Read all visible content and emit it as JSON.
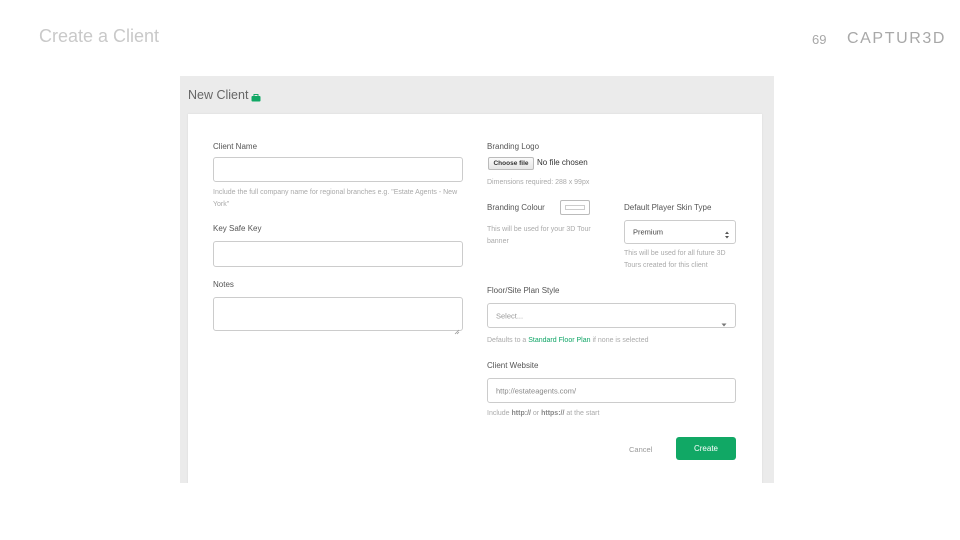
{
  "slide": {
    "title": "Create a Client",
    "page_number": "69",
    "brand": "CAPTUR3D"
  },
  "form": {
    "header_title": "New Client",
    "header_icon": "briefcase-icon",
    "client_name": {
      "label": "Client Name",
      "value": "",
      "hint": "Include the full company name for regional branches e.g. \"Estate Agents - New York\""
    },
    "key_safe_key": {
      "label": "Key Safe Key",
      "value": ""
    },
    "notes": {
      "label": "Notes",
      "value": ""
    },
    "branding_logo": {
      "label": "Branding Logo",
      "button_label": "Choose file",
      "file_status": "No file chosen",
      "hint": "Dimensions required: 288 x 99px"
    },
    "branding_colour": {
      "label": "Branding Colour",
      "hint": "This will be used for your 3D Tour banner"
    },
    "player_skin": {
      "label": "Default Player Skin Type",
      "selected": "Premium",
      "hint": "This will be used for all future 3D Tours created for this client"
    },
    "floor_plan_style": {
      "label": "Floor/Site Plan Style",
      "placeholder": "Select...",
      "hint_before": "Defaults to a ",
      "hint_link": "Standard Floor Plan",
      "hint_after": " if none is selected"
    },
    "client_website": {
      "label": "Client Website",
      "placeholder": "http://estateagents.com/",
      "hint_before": "Include ",
      "hint_bold_1": "http://",
      "hint_middle": " or ",
      "hint_bold_2": "https://",
      "hint_after": " at the start"
    },
    "actions": {
      "cancel_label": "Cancel",
      "create_label": "Create"
    }
  },
  "colors": {
    "accent": "#11a865",
    "link": "#0fa566",
    "frame_bg": "#ebebeb"
  }
}
